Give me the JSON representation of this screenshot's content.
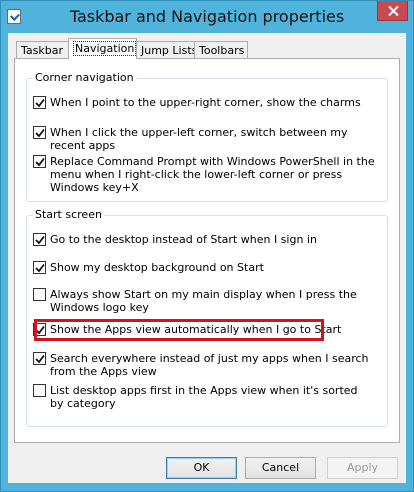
{
  "window": {
    "title": "Taskbar and Navigation properties"
  },
  "tabs": [
    {
      "label": "Taskbar",
      "active": false
    },
    {
      "label": "Navigation",
      "active": true
    },
    {
      "label": "Jump Lists",
      "active": false
    },
    {
      "label": "Toolbars",
      "active": false
    }
  ],
  "corner_navigation": {
    "title": "Corner navigation",
    "items": [
      {
        "label": "When I point to the upper-right corner, show the charms",
        "checked": true
      },
      {
        "label": "When I click the upper-left corner, switch between my recent apps",
        "checked": true
      },
      {
        "label": "Replace Command Prompt with Windows PowerShell in the menu when I right-click the lower-left corner or press Windows key+X",
        "checked": true
      }
    ]
  },
  "start_screen": {
    "title": "Start screen",
    "items": [
      {
        "label": "Go to the desktop instead of Start when I sign in",
        "checked": true
      },
      {
        "label": "Show my desktop background on Start",
        "checked": true
      },
      {
        "label": "Always show Start on my main display when I press the Windows logo key",
        "checked": false
      },
      {
        "label": "Show the Apps view automatically when I go to Start",
        "checked": true
      },
      {
        "label": "Search everywhere instead of just my apps when I search from the Apps view",
        "checked": true
      },
      {
        "label": "List desktop apps first in the Apps view when it's sorted by category",
        "checked": false
      }
    ]
  },
  "buttons": {
    "ok": "OK",
    "cancel": "Cancel",
    "apply": "Apply"
  },
  "colors": {
    "title_bar": "#4fb3dc",
    "close_button": "#c74b50",
    "highlight": "#d0141f"
  }
}
